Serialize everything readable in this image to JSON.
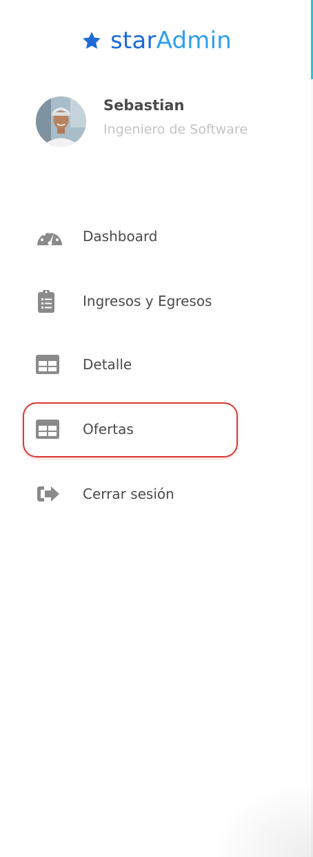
{
  "brand": {
    "name_part1": "star",
    "name_part2": "Admin",
    "logo_icon": "star-icon",
    "colors": {
      "part1": "#1e6bd6",
      "part2": "#2e9ff0"
    }
  },
  "profile": {
    "name": "Sebastian",
    "role": "Ingeniero de Software",
    "avatar": "user-avatar"
  },
  "nav": {
    "items": [
      {
        "label": "Dashboard",
        "icon": "speedometer-icon"
      },
      {
        "label": "Ingresos y Egresos",
        "icon": "clipboard-list-icon"
      },
      {
        "label": "Detalle",
        "icon": "table-icon"
      },
      {
        "label": "Ofertas",
        "icon": "table-icon",
        "highlighted": true
      },
      {
        "label": "Cerrar sesión",
        "icon": "logout-icon"
      }
    ]
  },
  "colors": {
    "highlight_border": "#d93a34",
    "icon_gray": "#8a8a8a",
    "text": "#4a4a4a",
    "muted": "#c4c4c4",
    "scroll_accent": "#26c6da"
  }
}
